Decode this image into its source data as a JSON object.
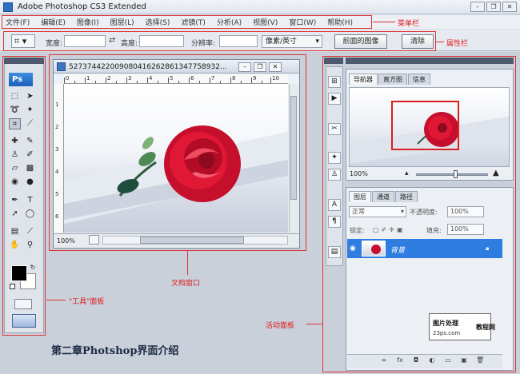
{
  "window": {
    "title": "Adobe Photoshop CS3 Extended"
  },
  "menu": [
    "文件(F)",
    "编辑(E)",
    "图像(I)",
    "图层(L)",
    "选择(S)",
    "滤镜(T)",
    "分析(A)",
    "视图(V)",
    "窗口(W)",
    "帮助(H)"
  ],
  "options_bar": {
    "width_label": "宽度:",
    "height_label": "高度:",
    "resolution_label": "分辨率:",
    "unit_select": "像素/英寸",
    "front_image_button": "前面的图像",
    "clear_button": "清除"
  },
  "annotations": {
    "menubar": "菜单栏",
    "options": "属性栏",
    "document": "文档窗口",
    "toolbox": "\"工具\"面板",
    "panels": "活动面板"
  },
  "document": {
    "title": "5273744220090804162628613477589​32...",
    "zoom": "100%",
    "ruler_h": [
      "0",
      "1",
      "2",
      "3",
      "4",
      "5",
      "6",
      "7",
      "8",
      "9",
      "10"
    ],
    "ruler_v": [
      "1",
      "2",
      "3",
      "4",
      "5",
      "6"
    ]
  },
  "navigator": {
    "tabs": [
      "导航器",
      "直方图",
      "信息"
    ],
    "zoom": "100%"
  },
  "layers": {
    "tabs": [
      "图层",
      "通道",
      "路径"
    ],
    "blend_mode": "正常",
    "opacity_label": "不透明度:",
    "opacity": "100%",
    "lock_label": "锁定:",
    "fill_label": "填充:",
    "fill": "100%",
    "layer_name": "背景"
  },
  "watermark": {
    "line1": "图片处理",
    "line2": "教程网",
    "line3": "23ps.com"
  },
  "caption": "第二章Photshop界面介绍",
  "colors": {
    "annotation": "#e01a1a",
    "layer_selected": "#2f7de0",
    "rose": "#d8122f"
  }
}
